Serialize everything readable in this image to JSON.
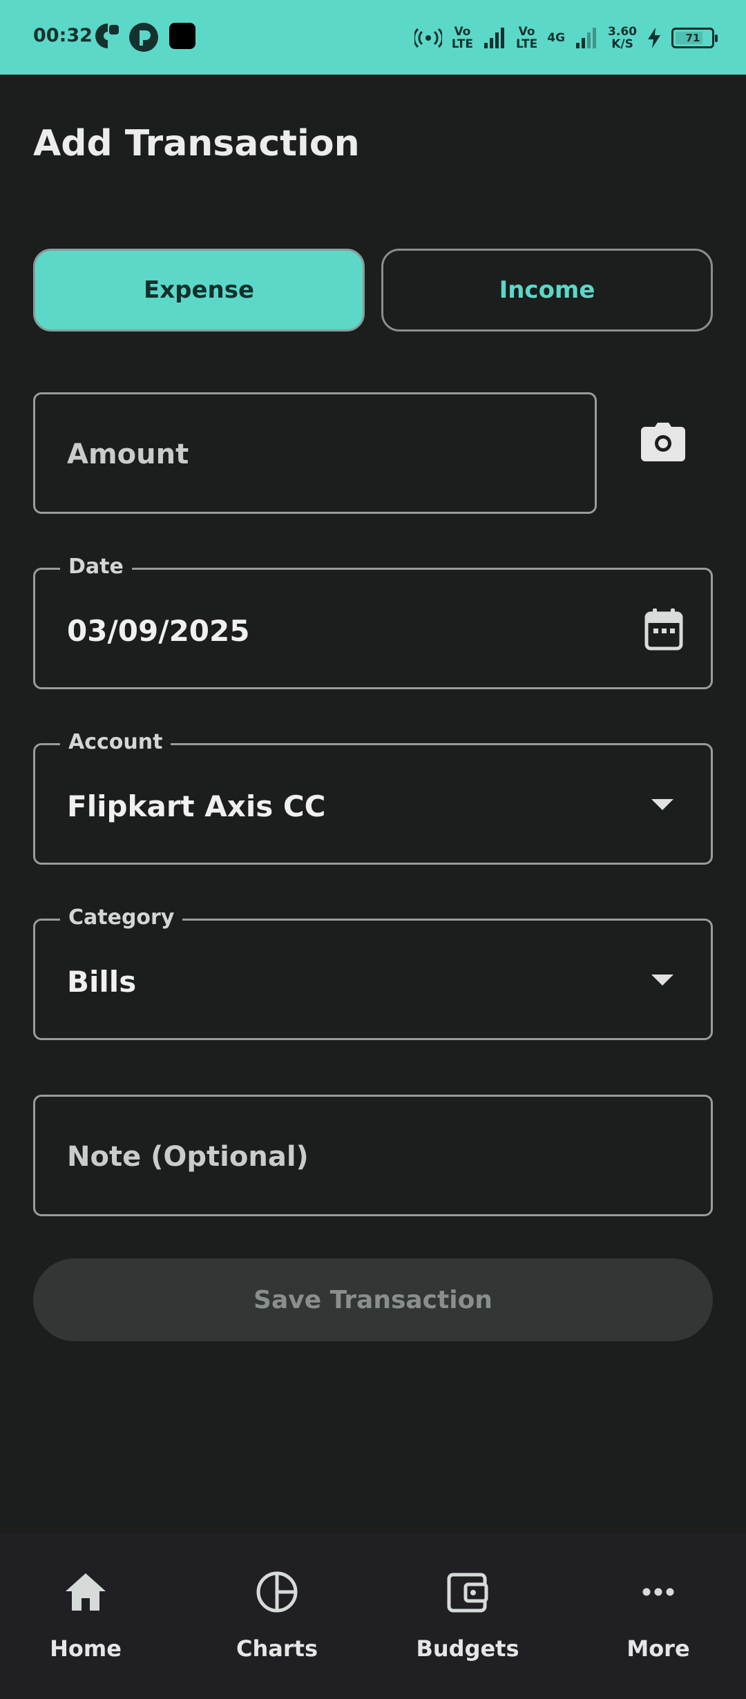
{
  "status_bar": {
    "time": "00:32",
    "net1_top": "Vo",
    "net1_bottom": "LTE",
    "net2_top": "Vo",
    "net2_bottom": "LTE",
    "net_type": "4G",
    "speed_top": "3.60",
    "speed_bottom": "K/S",
    "battery": "71"
  },
  "header": {
    "title": "Add Transaction"
  },
  "type_toggle": {
    "expense_label": "Expense",
    "income_label": "Income",
    "selected": "Expense"
  },
  "form": {
    "amount_placeholder": "Amount",
    "date_label": "Date",
    "date_value": "03/09/2025",
    "account_label": "Account",
    "account_value": "Flipkart Axis CC",
    "category_label": "Category",
    "category_value": "Bills",
    "note_placeholder": "Note (Optional)",
    "save_label": "Save Transaction"
  },
  "bottom_nav": {
    "items": [
      {
        "label": "Home",
        "icon": "home-icon"
      },
      {
        "label": "Charts",
        "icon": "pie-chart-icon"
      },
      {
        "label": "Budgets",
        "icon": "wallet-icon"
      },
      {
        "label": "More",
        "icon": "more-icon"
      }
    ]
  },
  "colors": {
    "accent": "#5bd8c8",
    "background": "#1c1d1d",
    "nav_background": "#202024"
  }
}
